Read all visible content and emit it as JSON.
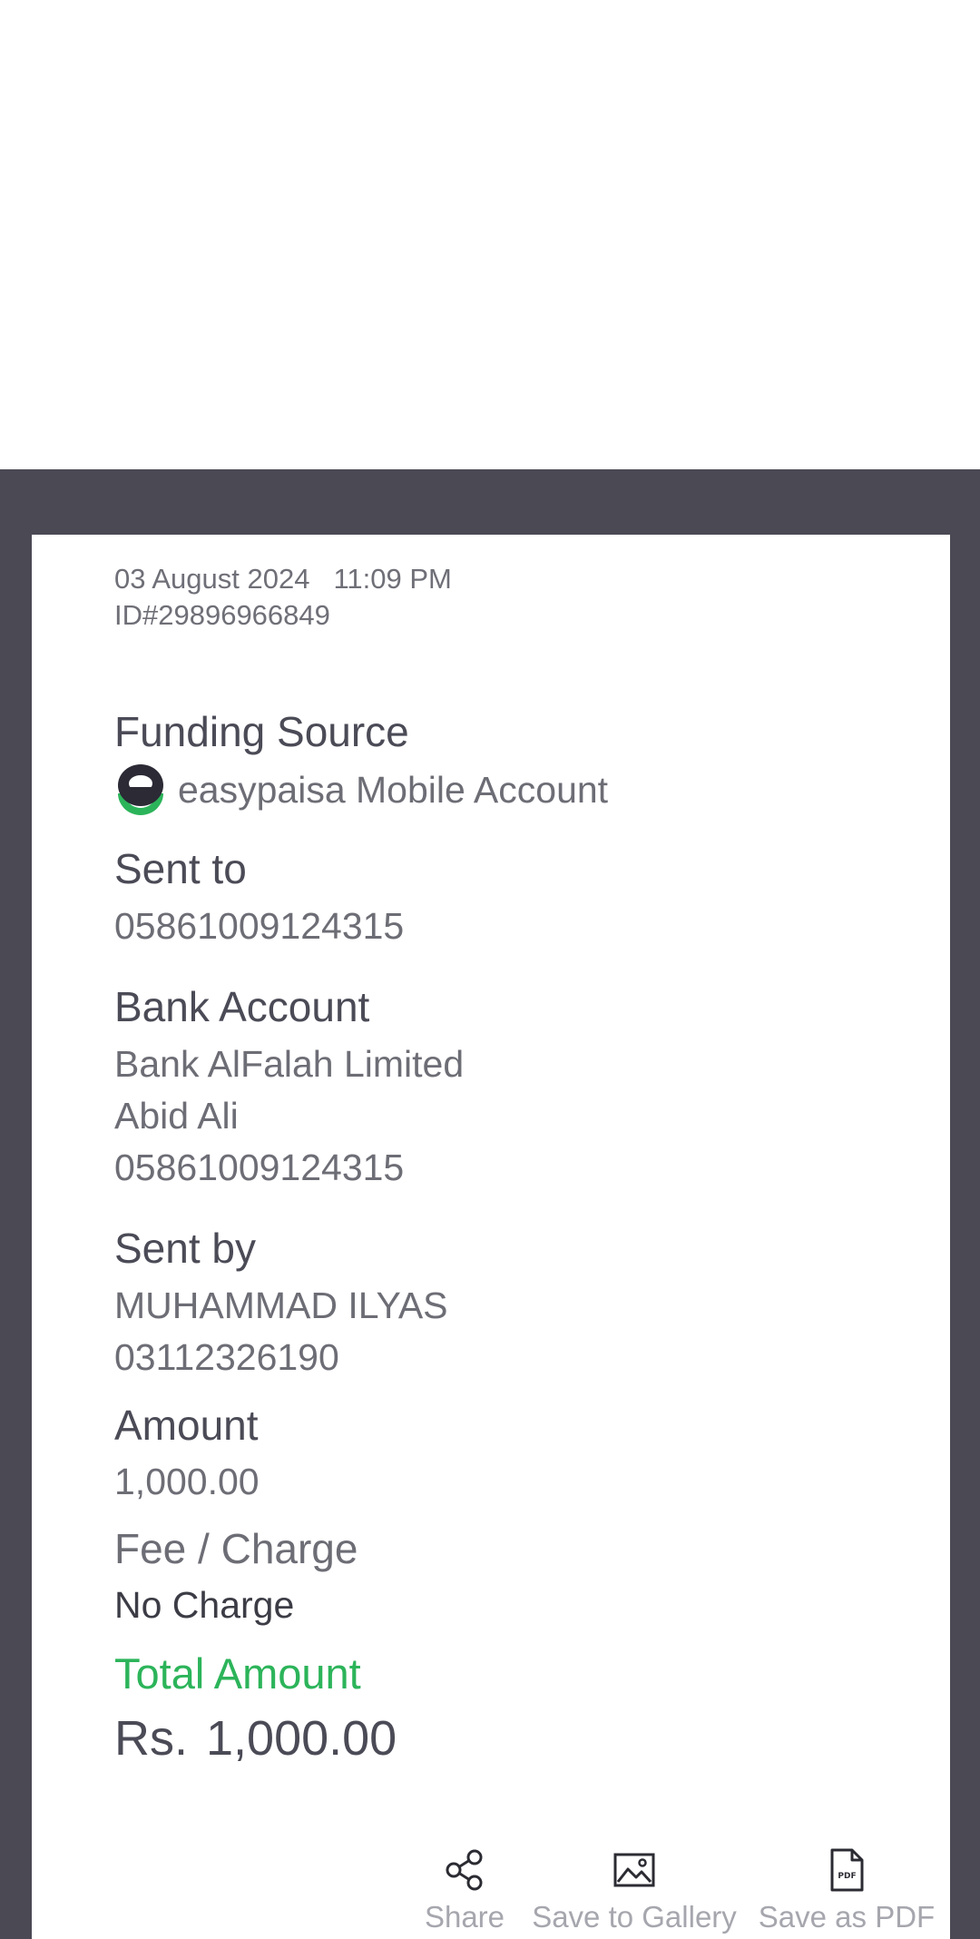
{
  "receipt": {
    "date": "03 August 2024",
    "time": "11:09 PM",
    "transaction_id": "ID#29896966849",
    "funding_source": {
      "label": "Funding Source",
      "value": "easypaisa Mobile Account",
      "icon": "easypaisa-logo-icon"
    },
    "sent_to": {
      "label": "Sent to",
      "value": "05861009124315"
    },
    "bank_account": {
      "label": "Bank Account",
      "bank_name": "Bank AlFalah Limited",
      "account_title": "Abid Ali",
      "account_number": "05861009124315"
    },
    "sent_by": {
      "label": "Sent by",
      "name": "MUHAMMAD ILYAS",
      "phone": "03112326190"
    },
    "amount": {
      "label": "Amount",
      "value": "1,000.00"
    },
    "fee": {
      "label": "Fee / Charge",
      "value": "No Charge"
    },
    "total": {
      "label": "Total Amount",
      "currency": "Rs.",
      "value": "1,000.00"
    }
  },
  "actions": {
    "share": {
      "label": "Share",
      "icon": "share-icon"
    },
    "gallery": {
      "label": "Save to Gallery",
      "icon": "image-icon"
    },
    "pdf": {
      "label": "Save as PDF",
      "icon": "pdf-file-icon",
      "icon_text": "PDF"
    }
  },
  "colors": {
    "overlay": "#4a4954",
    "accent_green": "#2cb45a",
    "logo_dark": "#2b2a35"
  }
}
